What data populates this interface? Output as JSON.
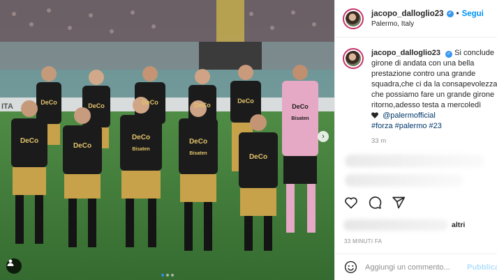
{
  "post": {
    "username": "jacopo_dalloglio23",
    "follow_label": "Segui",
    "location": "Palermo, Italy",
    "caption_lines": [
      "Si conclude",
      "girone di andata con una bella",
      "prestazione contro una grande",
      "squadra,che ci da la consapevolezza",
      "che possiamo fare un grande girone",
      "ritorno,adesso testa a mercoledì"
    ],
    "mention": "@palermofficial",
    "hashtags": "#forza #palermo #23",
    "caption_time": "33 m",
    "likes_suffix": "altri",
    "post_time": "33 MINUTI FA",
    "comment_placeholder": "Aggiungi un commento...",
    "publish_label": "Pubblica"
  },
  "photo": {
    "jersey_text": "DeCo",
    "sponsor_text": "Bisaten",
    "side_banner": "ITA"
  },
  "icons": {
    "verified": "verified-badge-icon",
    "like": "heart-icon",
    "comment": "comment-icon",
    "share": "share-icon",
    "emoji": "emoji-icon",
    "tag": "user-tag-icon",
    "next": "chevron-right-icon"
  },
  "colors": {
    "link": "#0095f6",
    "pitch": "#3f7d3a",
    "kit_black": "#1b1b1b",
    "kit_gold": "#c8a24a",
    "keeper_pink": "#e6a9c5"
  }
}
